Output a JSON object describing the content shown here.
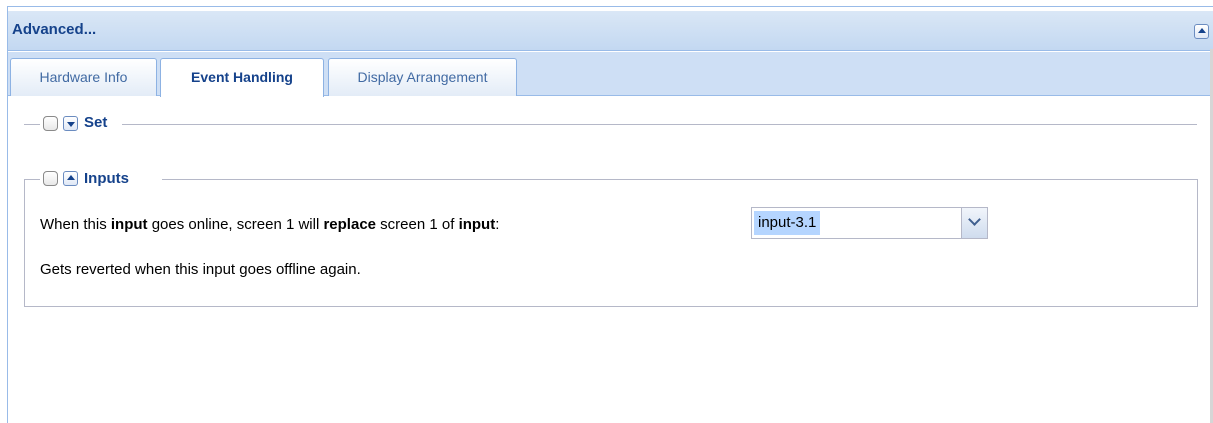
{
  "panel": {
    "title": "Advanced...",
    "tabs": [
      {
        "label": "Hardware Info",
        "active": false
      },
      {
        "label": "Event Handling",
        "active": true
      },
      {
        "label": "Display Arrangement",
        "active": false
      }
    ]
  },
  "set_section": {
    "legend": "Set",
    "collapsed": true,
    "checked": false
  },
  "inputs_section": {
    "legend": "Inputs",
    "collapsed": false,
    "checked": false,
    "rule_parts": {
      "p1": "When this ",
      "b1": "input",
      "p2": " goes online, screen 1 will ",
      "b2": "replace",
      "p3": " screen 1 of ",
      "b3": "input",
      "p4": ":"
    },
    "select_value": "input-3.1",
    "note": "Gets reverted when this input goes offline again."
  },
  "colors": {
    "header_text": "#15428b",
    "border": "#99bbe8",
    "selection": "#b5d5ff"
  }
}
